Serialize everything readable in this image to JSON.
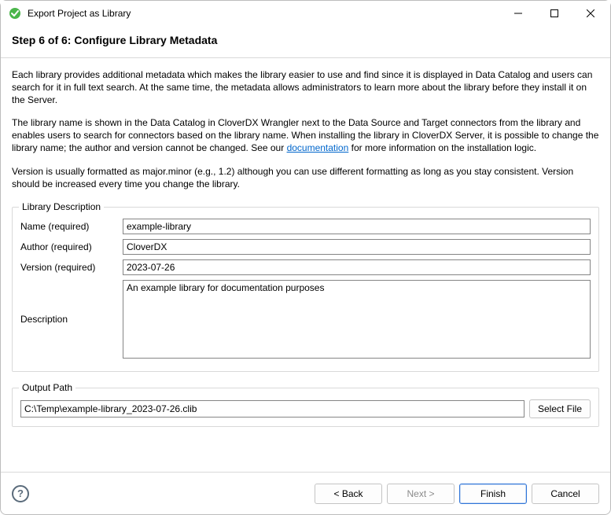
{
  "window_title": "Export Project as Library",
  "header": {
    "title": "Step 6 of 6: Configure Library Metadata"
  },
  "intro": {
    "p1": "Each library provides additional metadata which makes the library easier to use and find since it is displayed in Data Catalog and users can search for it in full text search. At the same time, the metadata allows administrators to learn more about the library before they install it on the Server.",
    "p2_pre": "The library name is shown in the Data Catalog in CloverDX Wrangler next to the Data Source and Target connectors from the library and enables users to search for connectors based on the library name. When installing the library in CloverDX Server, it is possible to change the library name; the author and version cannot be changed. See our ",
    "p2_link": "documentation",
    "p2_post": " for more information on the installation logic.",
    "p3": "Version is usually formatted as major.minor (e.g., 1.2) although you can use different formatting as long as you stay consistent. Version should be increased every time you change the library."
  },
  "group_library": {
    "legend": "Library Description",
    "name_label": "Name (required)",
    "name_value": "example-library",
    "author_label": "Author (required)",
    "author_value": "CloverDX",
    "version_label": "Version (required)",
    "version_value": "2023-07-26",
    "description_label": "Description",
    "description_value": "An example library for documentation purposes"
  },
  "group_output": {
    "legend": "Output Path",
    "path_value": "C:\\Temp\\example-library_2023-07-26.clib",
    "select_file": "Select File"
  },
  "buttons": {
    "back": "< Back",
    "next": "Next >",
    "finish": "Finish",
    "cancel": "Cancel"
  }
}
